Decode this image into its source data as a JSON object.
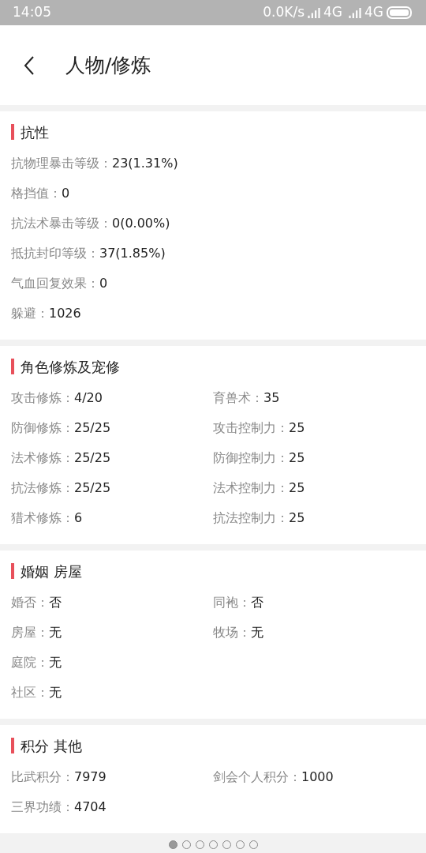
{
  "status_bar": {
    "time": "14:05",
    "speed": "0.0K/s",
    "network_1": "4G",
    "network_2": "4G"
  },
  "header": {
    "title": "人物/修炼"
  },
  "sections": [
    {
      "title": "抗性",
      "rows": [
        [
          {
            "label": "抗物理暴击等级：",
            "value": "23(1.31%)"
          }
        ],
        [
          {
            "label": "格挡值：",
            "value": "0"
          }
        ],
        [
          {
            "label": "抗法术暴击等级：",
            "value": "0(0.00%)"
          }
        ],
        [
          {
            "label": "抵抗封印等级：",
            "value": "37(1.85%)"
          }
        ],
        [
          {
            "label": "气血回复效果：",
            "value": "0"
          }
        ],
        [
          {
            "label": "躲避：",
            "value": "1026"
          }
        ]
      ]
    },
    {
      "title": "角色修炼及宠修",
      "rows": [
        [
          {
            "label": "攻击修炼：",
            "value": "4/20"
          },
          {
            "label": "育兽术：",
            "value": "35"
          }
        ],
        [
          {
            "label": "防御修炼：",
            "value": "25/25"
          },
          {
            "label": "攻击控制力：",
            "value": "25"
          }
        ],
        [
          {
            "label": "法术修炼：",
            "value": "25/25"
          },
          {
            "label": "防御控制力：",
            "value": "25"
          }
        ],
        [
          {
            "label": "抗法修炼：",
            "value": "25/25"
          },
          {
            "label": "法术控制力：",
            "value": "25"
          }
        ],
        [
          {
            "label": "猎术修炼：",
            "value": "6"
          },
          {
            "label": "抗法控制力：",
            "value": "25"
          }
        ]
      ]
    },
    {
      "title": "婚姻 房屋",
      "rows": [
        [
          {
            "label": "婚否：",
            "value": "否"
          },
          {
            "label": "同袍：",
            "value": "否"
          }
        ],
        [
          {
            "label": "房屋：",
            "value": "无"
          },
          {
            "label": "牧场：",
            "value": "无"
          }
        ],
        [
          {
            "label": "庭院：",
            "value": "无"
          }
        ],
        [
          {
            "label": "社区：",
            "value": "无"
          }
        ]
      ]
    },
    {
      "title": "积分 其他",
      "rows": [
        [
          {
            "label": "比武积分：",
            "value": "7979"
          },
          {
            "label": "剑会个人积分：",
            "value": "1000"
          }
        ],
        [
          {
            "label": "三界功绩：",
            "value": "4704"
          }
        ]
      ]
    }
  ],
  "pager": [
    {
      "selected": true
    },
    {
      "selected": false
    },
    {
      "selected": false
    },
    {
      "selected": false
    },
    {
      "selected": false
    },
    {
      "selected": false
    },
    {
      "selected": false
    }
  ]
}
